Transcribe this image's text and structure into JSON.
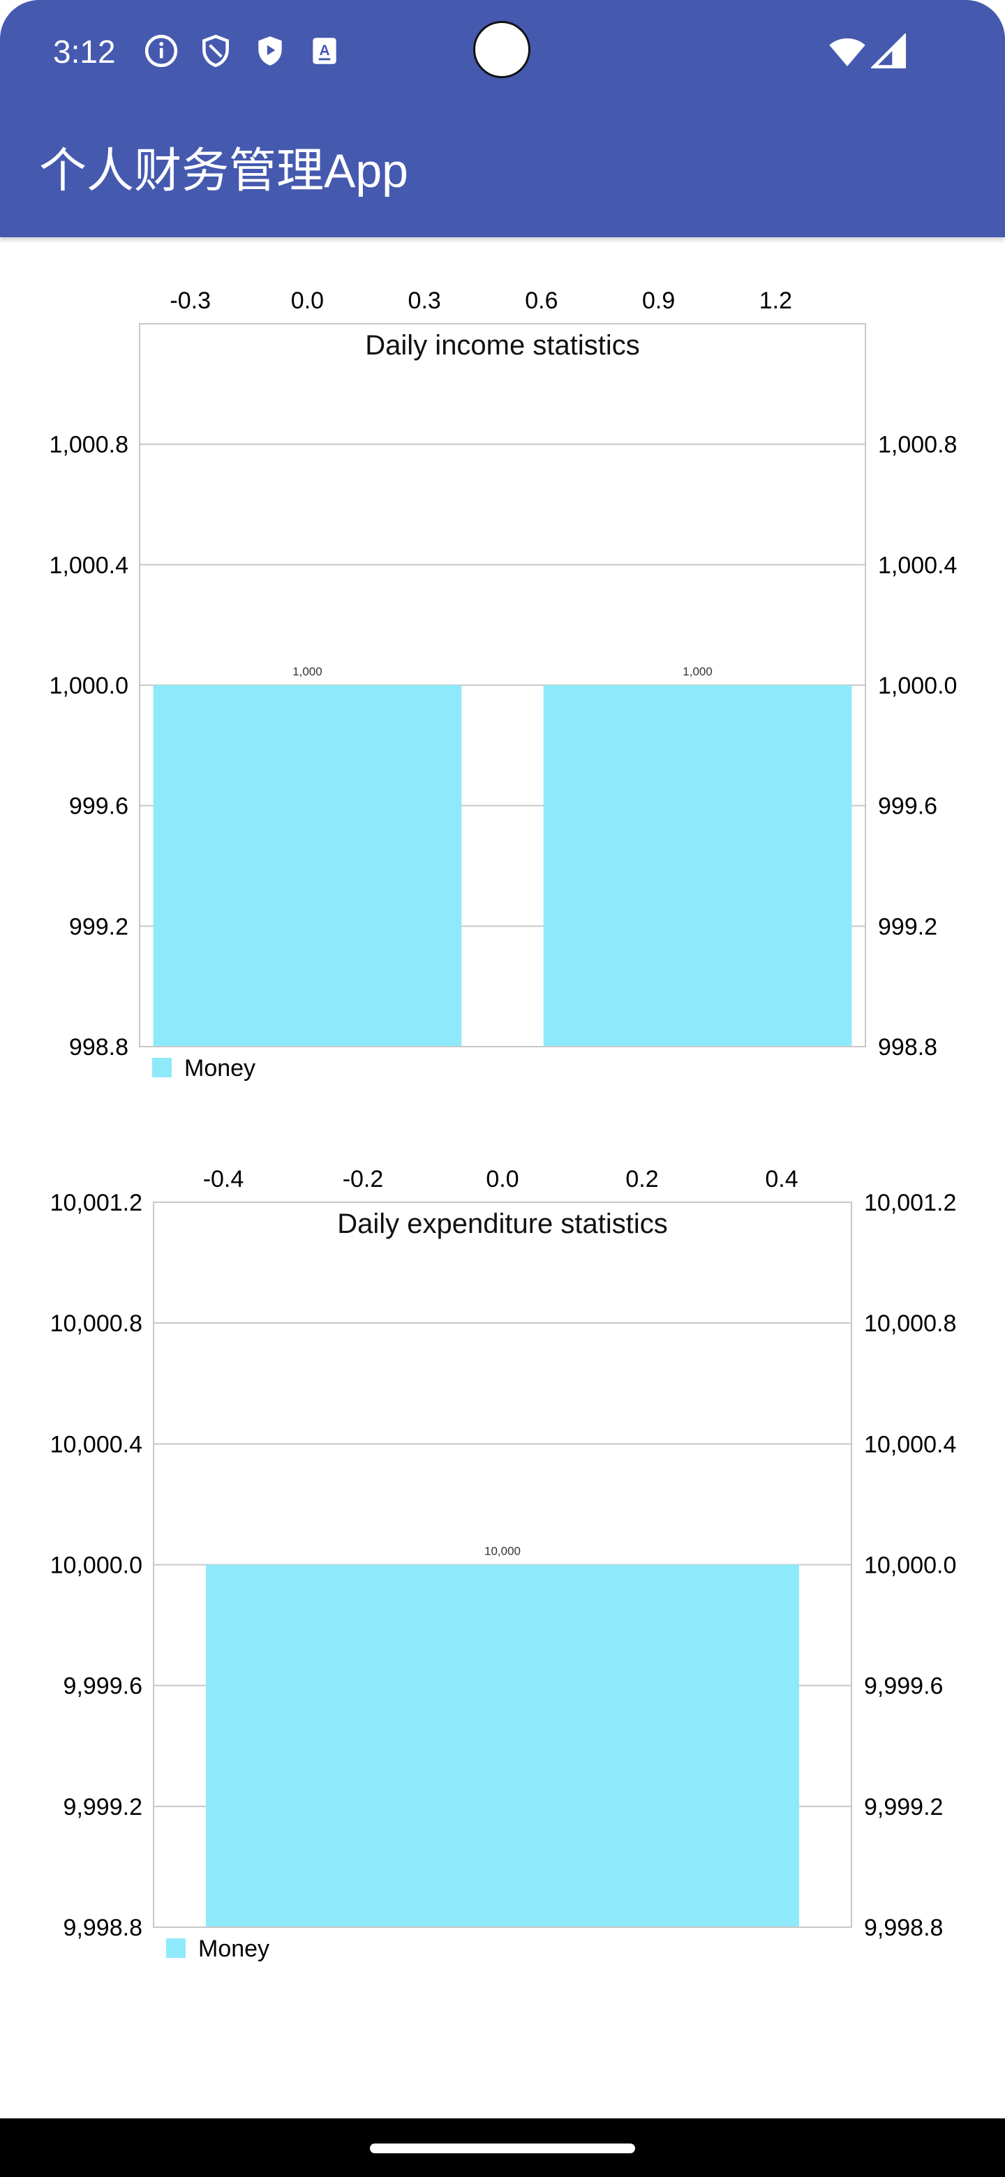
{
  "status_bar": {
    "time": "3:12",
    "icons_left": [
      "info-icon",
      "shield-outline-icon",
      "shield-play-icon",
      "translate-icon"
    ],
    "icons_right": [
      "wifi-icon",
      "signal-icon"
    ]
  },
  "app_bar": {
    "title": "个人财务管理App",
    "color": "#4559af"
  },
  "colors": {
    "bar": "#8eeafb",
    "grid": "#c8c8c8",
    "axis_text": "#000000"
  },
  "chart_data": [
    {
      "type": "bar",
      "title": "Daily income statistics",
      "legend": "Money",
      "legend_position": "bottom-left",
      "x_ticks": [
        "-0.3",
        "0.0",
        "0.3",
        "0.6",
        "0.9",
        "1.2"
      ],
      "y_ticks": [
        "1,000.8",
        "1,000.4",
        "1,000.0",
        "999.6",
        "999.2",
        "998.8"
      ],
      "ylim": [
        998.8,
        1001.2
      ],
      "xlim": [
        -0.43,
        1.43
      ],
      "bars": [
        {
          "x": 0,
          "value": 1000,
          "label": "1,000"
        },
        {
          "x": 1,
          "value": 1000,
          "label": "1,000"
        }
      ],
      "bar_width": 0.79,
      "grid": true,
      "right_axis": true
    },
    {
      "type": "bar",
      "title": "Daily expenditure statistics",
      "legend": "Money",
      "legend_position": "bottom-left",
      "x_ticks": [
        "-0.4",
        "-0.2",
        "0.0",
        "0.2",
        "0.4"
      ],
      "y_ticks": [
        "10,001.2",
        "10,000.8",
        "10,000.4",
        "10,000.0",
        "9,999.6",
        "9,999.2",
        "9,998.8"
      ],
      "ylim": [
        9998.8,
        10001.2
      ],
      "xlim": [
        -0.5,
        0.5
      ],
      "bars": [
        {
          "x": 0,
          "value": 10000,
          "label": "10,000"
        }
      ],
      "bar_width": 0.85,
      "grid": true,
      "right_axis": true
    }
  ]
}
